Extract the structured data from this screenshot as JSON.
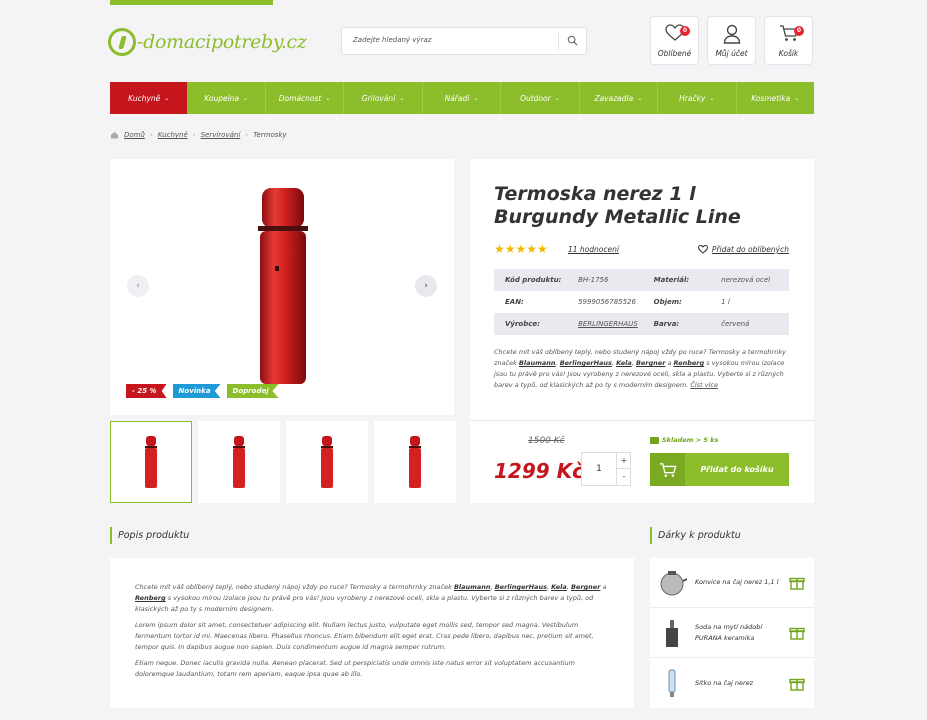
{
  "header": {
    "logo_text": "-domacipotreby.cz",
    "search_placeholder": "Zadejte hledaný výraz",
    "favorites": {
      "label": "Oblíbené",
      "count": "0"
    },
    "account": {
      "label": "Můj účet"
    },
    "cart": {
      "label": "Košík",
      "count": "0"
    }
  },
  "nav": [
    {
      "label": "Kuchyně",
      "active": true
    },
    {
      "label": "Koupelna"
    },
    {
      "label": "Domácnost"
    },
    {
      "label": "Grilování"
    },
    {
      "label": "Nářadí"
    },
    {
      "label": "Outdoor"
    },
    {
      "label": "Zavazadla"
    },
    {
      "label": "Hračky"
    },
    {
      "label": "Kosmetika"
    }
  ],
  "breadcrumb": {
    "home": "Domů",
    "c1": "Kuchyně",
    "c2": "Servírování",
    "current": "Termosky"
  },
  "badges": {
    "discount": "- 25 %",
    "new": "Novinka",
    "sale": "Doprodej"
  },
  "product": {
    "title": "Termoska nerez 1 l Burgundy Metallic Line",
    "rating_stars": 5,
    "reviews": "11 hodnocení",
    "add_fav": "Přidat do oblíbených",
    "specs": {
      "code_k": "Kód produktu:",
      "code_v": "BH-1756",
      "material_k": "Materiál:",
      "material_v": "nerezová ocel",
      "ean_k": "EAN:",
      "ean_v": "5999056785526",
      "volume_k": "Objem:",
      "volume_v": "1 l",
      "maker_k": "Výrobce:",
      "maker_v": "BERLINGERHAUS",
      "color_k": "Barva:",
      "color_v": "červená"
    },
    "desc": {
      "t1": "Chcete mít váš oblíbený teplý, nebo studený nápoj vždy po ruce? Termosky a termohrnky značek ",
      "b1": "Blaumann",
      "s1": ", ",
      "b2": "BerlingerHaus",
      "s2": ", ",
      "b3": "Kela",
      "s3": ", ",
      "b4": "Bergner",
      "s4": " a ",
      "b5": "Renberg",
      "t2": " s vysokou mírou izolace jsou tu právě pro vás! Jsou vyrobeny z nerezové oceli, skla a plastu. Vyberte si z různých barev a typů, od klasických až po ty s moderním designem. ",
      "more": "Číst více"
    },
    "old_price": "1500 Kč",
    "price": "1299 Kč",
    "stock": "Skladem > 5 ks",
    "qty": "1",
    "add_cart": "Přidat do košíku"
  },
  "description": {
    "heading": "Popis produktu",
    "p1a": "Chcete mít váš oblíbený teplý, nebo studený nápoj vždy po ruce? Termosky a termohrnky značek ",
    "p1b": "Blaumann",
    "p1c": ", ",
    "p1d": "BerlingerHaus",
    "p1e": ", ",
    "p1f": "Kela",
    "p1g": ", ",
    "p1h": "Bergner",
    "p1i": " a ",
    "p1j": "Renberg",
    "p1k": " s vysokou mírou izolace jsou tu právě pro vás! Jsou vyrobeny z nerezové oceli, skla a plastu. Vyberte si z různých barev a typů, od klasických až po ty s moderním designem.",
    "p2": "Lorem ipsum dolor sit amet, consectetuer adipiscing elit. Nullam lectus justo, vulputate eget mollis sed, tempor sed magna. Vestibulum fermentum tortor id mi. Maecenas libero. Phasellus rhoncus. Etiam bibendum elit eget erat. Cras pede libero, dapibus nec, pretium sit amet, tempor quis. In dapibus augue non sapien. Duis condimentum augue id magna semper rutrum.",
    "p3": "Etiam neque. Donec iaculis gravida nulla. Aenean placerat. Sed ut perspiciatis unde omnis iste natus error sit voluptatem accusantium doloremque laudantium, totam rem aperiam, eaque ipsa quae ab illo."
  },
  "gifts": {
    "heading": "Dárky k produktu",
    "items": [
      {
        "name": "Konvice na čaj nerez 1,1 l"
      },
      {
        "name": "Soda na mytí nádobí PURANA keramika"
      },
      {
        "name": "Sítko na čaj nerez"
      }
    ]
  },
  "colors": {
    "green": "#8cbd2b",
    "red": "#c5161d",
    "blue": "#1e9ad6",
    "star": "#f5b800"
  }
}
